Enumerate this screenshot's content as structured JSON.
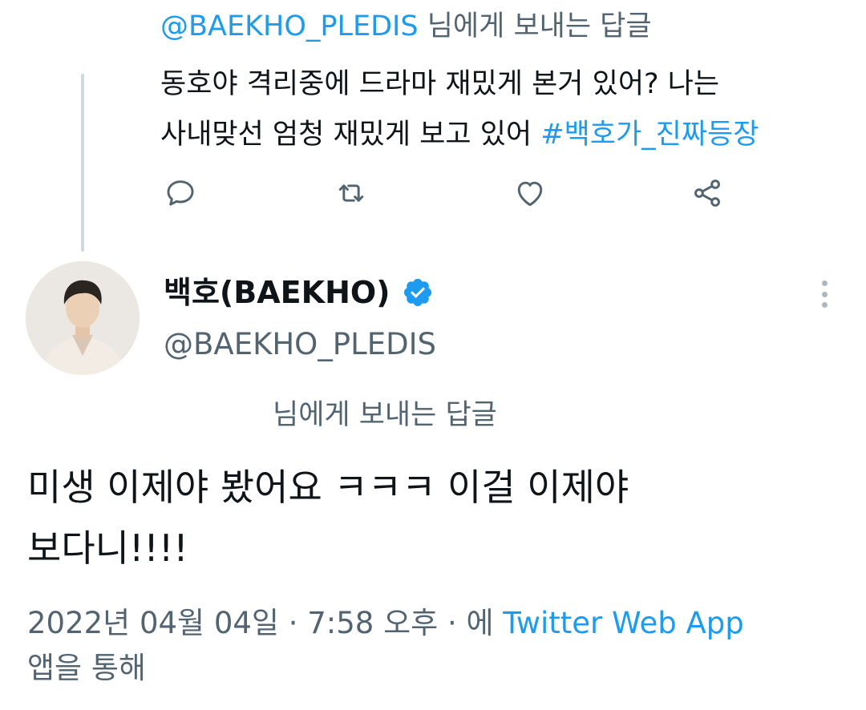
{
  "parent_tweet": {
    "reply_to_handle": "@BAEKHO_PLEDIS",
    "reply_to_suffix": " 님에게 보내는 답글",
    "text_line1": "동호야 격리중에 드라마 재밌게 본거 있어? 나는",
    "text_line2_prefix": "사내맞선 엄청 재밌게 보고 있어 ",
    "hashtag": "#백호가_진짜등장",
    "actions": {
      "reply_icon": "reply-icon",
      "retweet_icon": "retweet-icon",
      "like_icon": "heart-icon",
      "share_icon": "share-icon"
    }
  },
  "tweet": {
    "display_name": "백호(BAEKHO)",
    "verified": true,
    "handle": "@BAEKHO_PLEDIS",
    "reply_context": "님에게 보내는 답글",
    "text_line1": "미생 이제야 봤어요 ㅋㅋㅋ 이걸 이제야",
    "text_line2": "보다니!!!!",
    "timestamp": "2022년 04월 04일 · 7:58 오후 · 에 ",
    "source_app": "Twitter Web App",
    "source_suffix": "앱을 통해"
  },
  "colors": {
    "accent": "#1d9bf0",
    "text": "#0f1419",
    "muted": "#536471",
    "thread_line": "#cfd9de"
  }
}
